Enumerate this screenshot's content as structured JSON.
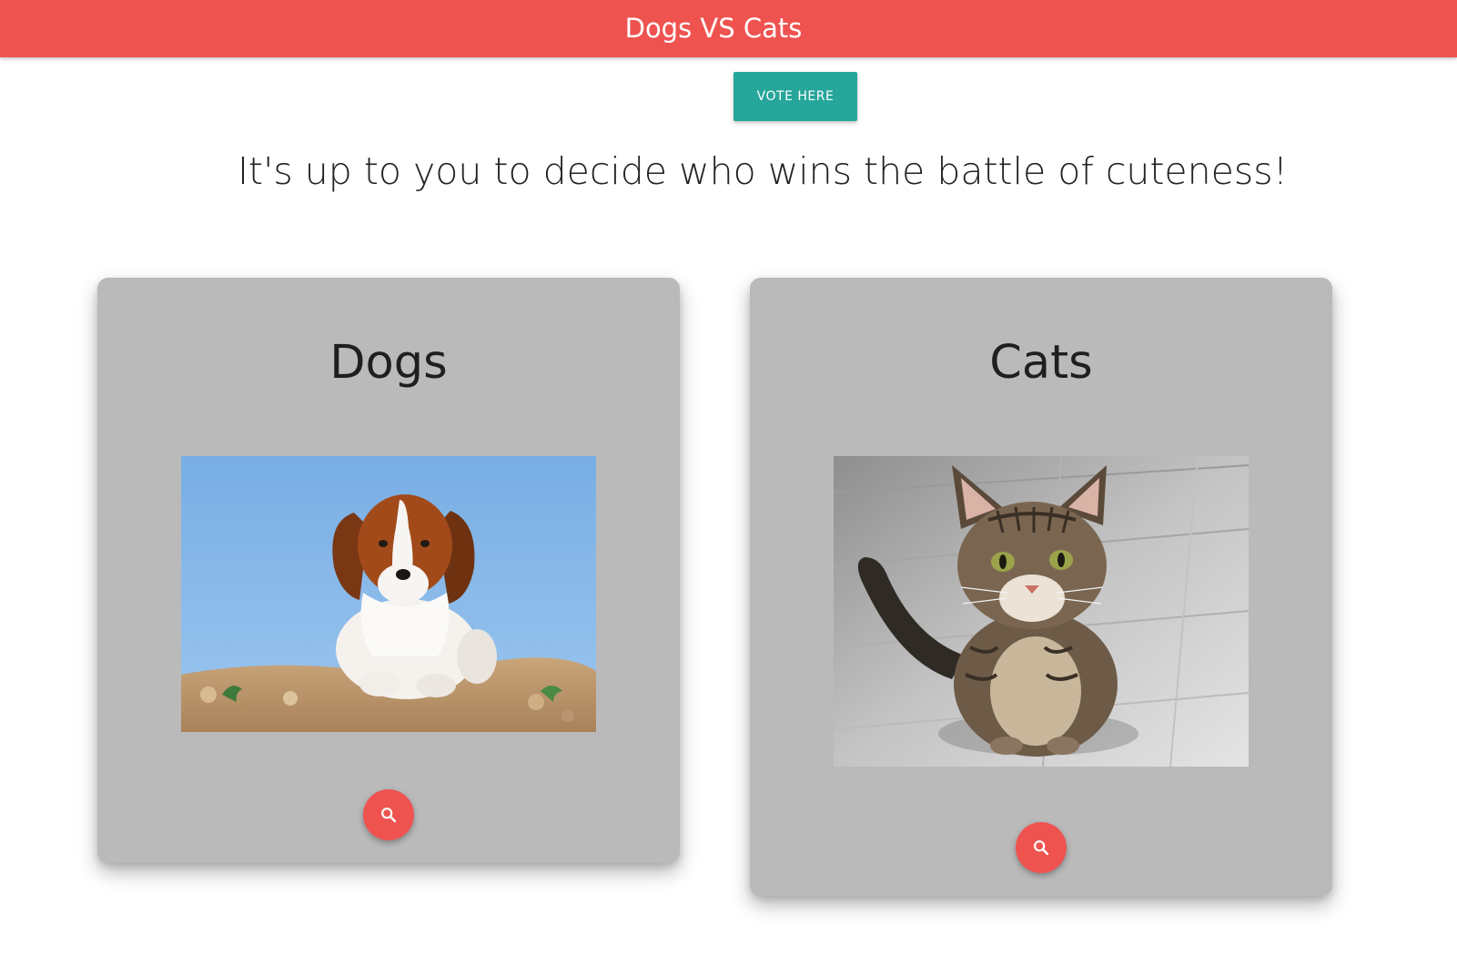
{
  "header": {
    "title": "Dogs VS Cats",
    "color": "#ef5350"
  },
  "vote_button": {
    "label": "VOTE HERE",
    "color": "#26a69a"
  },
  "tagline": "It's up to you to decide who wins the battle of cuteness!",
  "cards": [
    {
      "title": "Dogs",
      "image": "dog-photo",
      "action_icon": "search-icon"
    },
    {
      "title": "Cats",
      "image": "cat-photo",
      "action_icon": "search-icon"
    }
  ],
  "colors": {
    "card_background": "#bababa",
    "fab": "#ef5350"
  }
}
